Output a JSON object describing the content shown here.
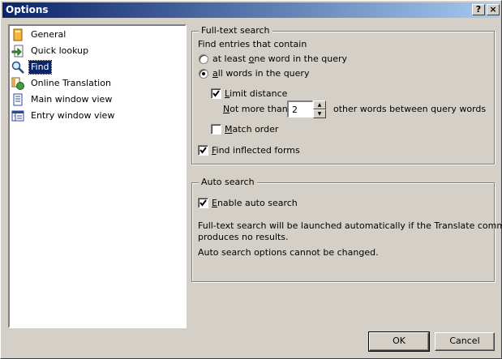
{
  "window": {
    "title": "Options",
    "help_button": "?",
    "close_button": "×"
  },
  "categories": [
    {
      "label": "General",
      "icon": "general-icon"
    },
    {
      "label": "Quick lookup",
      "icon": "quick-lookup-icon"
    },
    {
      "label": "Find",
      "icon": "find-icon",
      "selected": true
    },
    {
      "label": "Online Translation",
      "icon": "online-translation-icon"
    },
    {
      "label": "Main window view",
      "icon": "main-window-view-icon"
    },
    {
      "label": "Entry window view",
      "icon": "entry-window-view-icon"
    }
  ],
  "fulltext": {
    "title": "Full-text search",
    "find_entries_label": "Find entries that contain",
    "option_one_word": {
      "pre": "at least ",
      "key": "o",
      "post": "ne word in the query",
      "checked": false
    },
    "option_all_words": {
      "pre": "",
      "key": "a",
      "post": "ll words in the query",
      "checked": true
    },
    "limit_distance": {
      "pre": "",
      "key": "L",
      "post": "imit distance",
      "checked": true
    },
    "not_more_than": {
      "pre": "",
      "key": "N",
      "post": "ot more than"
    },
    "distance_value": "2",
    "other_words_label": "other words between query words",
    "match_order": {
      "pre": "",
      "key": "M",
      "post": "atch order",
      "checked": false
    },
    "inflected_forms": {
      "pre": "",
      "key": "F",
      "post": "ind inflected forms",
      "checked": true
    }
  },
  "autosearch": {
    "title": "Auto search",
    "enable": {
      "pre": "",
      "key": "E",
      "post": "nable auto search",
      "checked": true
    },
    "info_line1": "Full-text search will be launched automatically if the Translate command",
    "info_line2": "produces no results.",
    "note": "Auto search options cannot be changed."
  },
  "buttons": {
    "ok": "OK",
    "cancel": "Cancel"
  }
}
